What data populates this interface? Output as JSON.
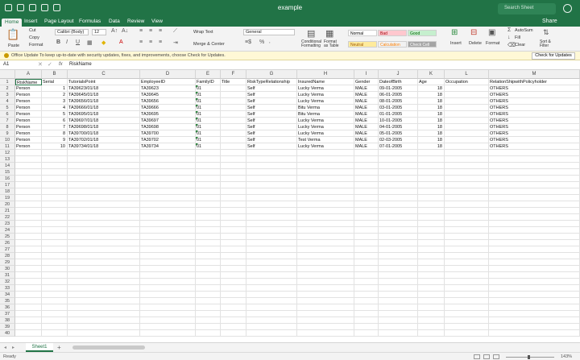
{
  "window": {
    "title": "example",
    "search_placeholder": "Search Sheet",
    "share_label": "Share"
  },
  "ribbon_tabs": [
    "Home",
    "Insert",
    "Page Layout",
    "Formulas",
    "Data",
    "Review",
    "View"
  ],
  "ribbon": {
    "paste": "Paste",
    "cut": "Cut",
    "copy": "Copy",
    "format": "Format",
    "font_name": "Calibri (Body)",
    "font_size": "12",
    "wrap_text": "Wrap Text",
    "merge_center": "Merge & Center",
    "number_format": "General",
    "conditional_formatting": "Conditional Formatting",
    "format_as_table": "Format as Table",
    "styles": [
      "Normal",
      "Bad",
      "Good",
      "Neutral",
      "Calculation",
      "Check Cell"
    ],
    "insert": "Insert",
    "delete": "Delete",
    "format_cells": "Format",
    "autosum": "AutoSum",
    "fill": "Fill",
    "clear": "Clear",
    "sort_filter": "Sort & Filter"
  },
  "update_bar": {
    "text": "Office Update  To keep up-to-date with security updates, fixes, and improvements, choose Check for Updates.",
    "button": "Check for Updates"
  },
  "formula_bar": {
    "name_box": "A1",
    "fx": "fx",
    "value": "RiskName"
  },
  "columns": [
    "A",
    "B",
    "C",
    "D",
    "E",
    "F",
    "G",
    "H",
    "I",
    "J",
    "K",
    "L",
    "M"
  ],
  "header_row": [
    "RiskName",
    "Serial",
    "TutorialsPoint",
    "EmployeeID",
    "FamilyID",
    "Title",
    "RiskTypeRelationship",
    "InsuredName",
    "Gender",
    "DateofBirth",
    "Age",
    "Occupation",
    "RelationShipwithPolicyholder"
  ],
  "rows": [
    [
      "Person",
      "1",
      "TA39623/01/18",
      "TA39623",
      "01",
      "",
      "Self",
      "Lucky  Verma",
      "MALE",
      "09-01-2005",
      "18",
      "",
      "OTHERS"
    ],
    [
      "Person",
      "2",
      "TA39645/01/18",
      "TA39645",
      "01",
      "",
      "Self",
      "Lucky  Verma",
      "MALE",
      "06-01-2005",
      "18",
      "",
      "OTHERS"
    ],
    [
      "Person",
      "3",
      "TA39656/01/18",
      "TA39656",
      "01",
      "",
      "Self",
      "Lucky  Verma",
      "MALE",
      "08-01-2005",
      "18",
      "",
      "OTHERS"
    ],
    [
      "Person",
      "4",
      "TA39666/01/18",
      "TA39666",
      "01",
      "",
      "Self",
      "Bitu  Verma",
      "MALE",
      "03-01-2005",
      "18",
      "",
      "OTHERS"
    ],
    [
      "Person",
      "5",
      "TA39695/01/18",
      "TA39695",
      "01",
      "",
      "Self",
      "Bitu Verma",
      "MALE",
      "01-01-2005",
      "18",
      "",
      "OTHERS"
    ],
    [
      "Person",
      "6",
      "TA39697/01/18",
      "TA39697",
      "01",
      "",
      "Self",
      "Lucky  Verma",
      "MALE",
      "10-01-2005",
      "18",
      "",
      "OTHERS"
    ],
    [
      "Person",
      "7",
      "TA39698/01/18",
      "TA39698",
      "01",
      "",
      "Self",
      "Lucky  Verma",
      "MALE",
      "04-01-2005",
      "18",
      "",
      "OTHERS"
    ],
    [
      "Person",
      "8",
      "TA39700/01/18",
      "TA39700",
      "01",
      "",
      "Self",
      "Lucky  Verma",
      "MALE",
      "05-01-2005",
      "18",
      "",
      "OTHERS"
    ],
    [
      "Person",
      "9",
      "TA39702/01/18",
      "TA39702",
      "01",
      "",
      "Self",
      "Test Verma",
      "MALE",
      "02-03-2005",
      "18",
      "",
      "OTHERS"
    ],
    [
      "Person",
      "10",
      "TA39734/01/18",
      "TA39734",
      "01",
      "",
      "Self",
      "Lucky  Verma",
      "MALE",
      "07-01-2005",
      "18",
      "",
      "OTHERS"
    ]
  ],
  "row_count": 40,
  "sheet_tab": "Sheet1",
  "status": {
    "ready": "Ready",
    "zoom": "143%"
  },
  "colors": {
    "accent": "#217346"
  }
}
